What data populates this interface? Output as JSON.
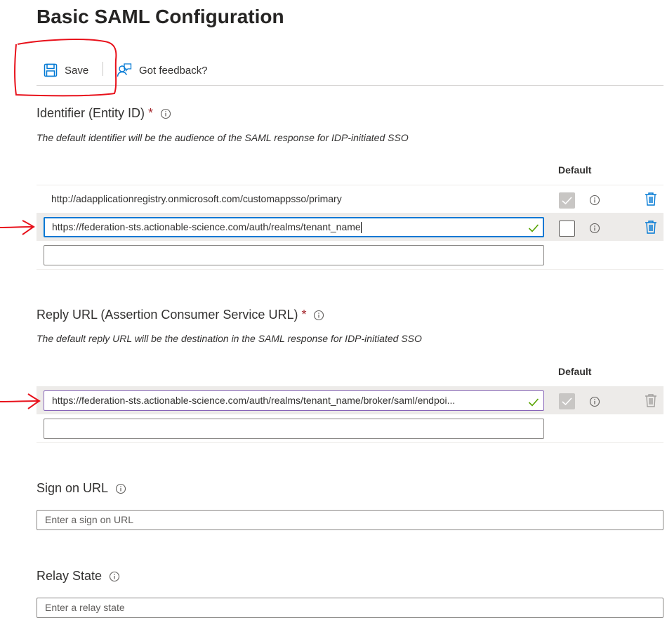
{
  "page": {
    "title": "Basic SAML Configuration"
  },
  "toolbar": {
    "save_label": "Save",
    "feedback_label": "Got feedback?"
  },
  "identifier": {
    "title": "Identifier (Entity ID)",
    "required_mark": "*",
    "description": "The default identifier will be the audience of the SAML response for IDP-initiated SSO",
    "default_header": "Default",
    "rows": [
      {
        "value": "http://adapplicationregistry.onmicrosoft.com/customappsso/primary",
        "default_checked": true,
        "editable": false
      },
      {
        "value": "https://federation-sts.actionable-science.com/auth/realms/tenant_name",
        "default_checked": false,
        "editable": true,
        "valid": true
      }
    ],
    "new_value": ""
  },
  "reply_url": {
    "title": "Reply URL (Assertion Consumer Service URL)",
    "required_mark": "*",
    "description": "The default reply URL will be the destination in the SAML response for IDP-initiated SSO",
    "default_header": "Default",
    "rows": [
      {
        "value": "https://federation-sts.actionable-science.com/auth/realms/tenant_name/broker/saml/endpoi...",
        "default_checked": true,
        "editable": true,
        "valid": true
      }
    ],
    "new_value": ""
  },
  "sign_on_url": {
    "title": "Sign on URL",
    "placeholder": "Enter a sign on URL"
  },
  "relay_state": {
    "title": "Relay State",
    "placeholder": "Enter a relay state"
  },
  "colors": {
    "accent": "#0078d4",
    "required": "#a4262c",
    "annotation": "#e8111b",
    "valid": "#57a300"
  }
}
